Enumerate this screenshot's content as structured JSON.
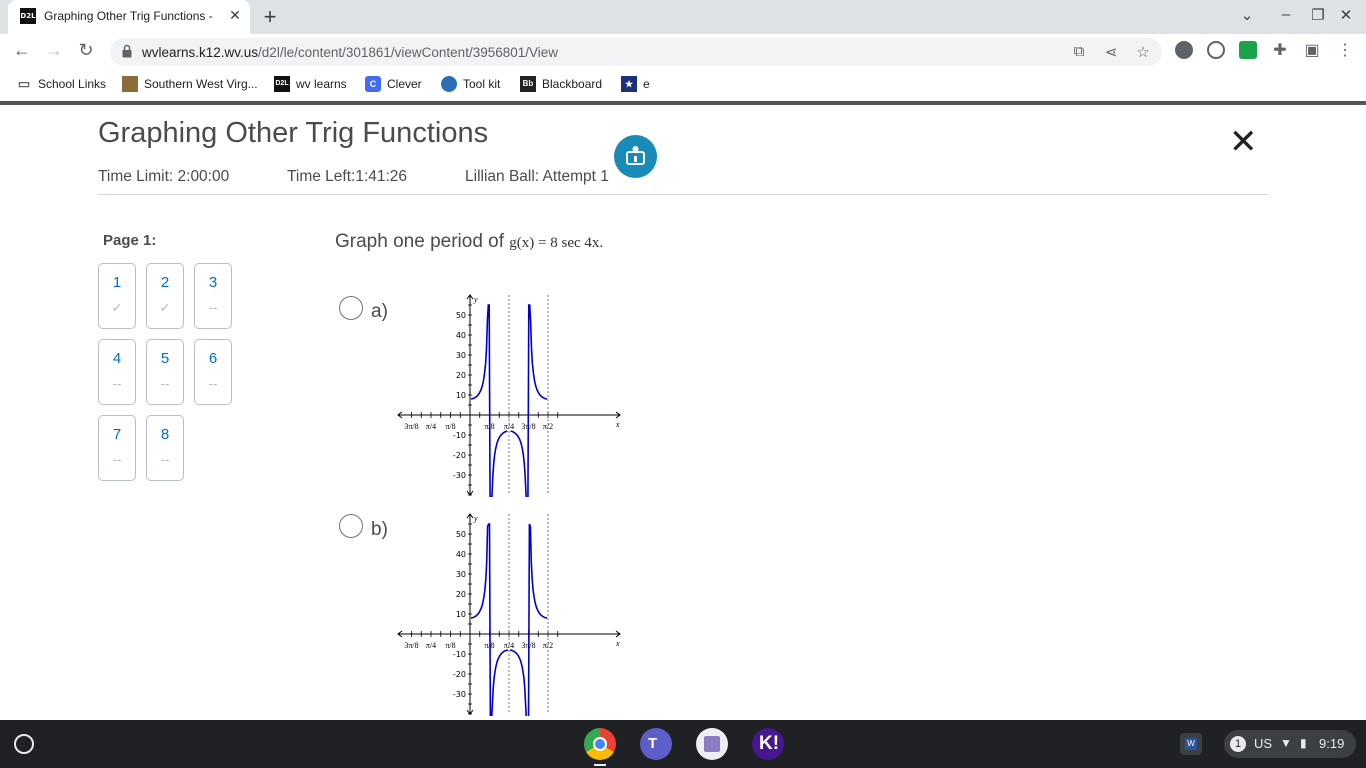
{
  "browser": {
    "tab_title": "Graphing Other Trig Functions - ",
    "tab_favicon": "D2L",
    "url_host": "wvlearns.k12.wv.us",
    "url_path": "/d2l/le/content/301861/viewContent/3956801/View"
  },
  "bookmarks": [
    {
      "label": "School Links",
      "icon": "folder-icon"
    },
    {
      "label": "Southern West Virg...",
      "icon": "southern-wv-icon"
    },
    {
      "label": "wv learns",
      "icon": "d2l-icon",
      "icon_text": "D2L"
    },
    {
      "label": "Clever",
      "icon": "clever-icon",
      "icon_text": "C"
    },
    {
      "label": "Tool kit",
      "icon": "toolkit-icon"
    },
    {
      "label": "Blackboard",
      "icon": "blackboard-icon",
      "icon_text": "Bb"
    },
    {
      "label": "e",
      "icon": "star-badge-icon"
    }
  ],
  "quiz": {
    "title": "Graphing Other Trig Functions",
    "time_limit": "Time Limit: 2:00:00",
    "time_left": "Time Left:1:41:26",
    "attempt": "Lillian Ball: Attempt 1",
    "page_label": "Page 1:",
    "questions": [
      {
        "num": "1",
        "status": "✓"
      },
      {
        "num": "2",
        "status": "✓"
      },
      {
        "num": "3",
        "status": "--"
      },
      {
        "num": "4",
        "status": "--"
      },
      {
        "num": "5",
        "status": "--"
      },
      {
        "num": "6",
        "status": "--"
      },
      {
        "num": "7",
        "status": "--"
      },
      {
        "num": "8",
        "status": "--"
      }
    ],
    "prompt": "Graph one period of ",
    "prompt_math": "g(x) = 8 sec 4x.",
    "options": [
      {
        "label": "a)"
      },
      {
        "label": "b)"
      }
    ]
  },
  "graph_labels": {
    "y_axis": "y",
    "x_axis": "x",
    "y_ticks": [
      "50",
      "40",
      "30",
      "20",
      "10",
      "-10",
      "-20",
      "-30"
    ],
    "x_ticks": [
      "3π/8",
      "π/4",
      "π/8",
      "π/8",
      "π/4",
      "3π/8",
      "π/2"
    ]
  },
  "taskbar": {
    "notification_count": "1",
    "keyboard": "US",
    "time": "9:19"
  },
  "colors": {
    "accent": "#006fbf",
    "fab": "#1a8bb6",
    "curve": "#0000cc"
  }
}
